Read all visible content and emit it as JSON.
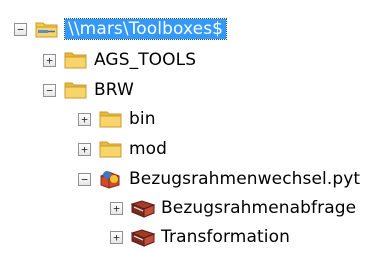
{
  "tree": {
    "root": {
      "label": "\\\\mars\\Toolboxes$",
      "toggle": "−",
      "icon": "folder-connection-icon",
      "selected": true
    },
    "items": [
      {
        "label": "AGS_TOOLS",
        "toggle": "+",
        "icon": "folder-icon"
      },
      {
        "label": "BRW",
        "toggle": "−",
        "icon": "folder-icon"
      },
      {
        "label": "bin",
        "toggle": "+",
        "icon": "folder-icon"
      },
      {
        "label": "mod",
        "toggle": "+",
        "icon": "folder-icon"
      },
      {
        "label": "Bezugsrahmenwechsel.pyt",
        "toggle": "−",
        "icon": "python-toolbox-icon"
      },
      {
        "label": "Bezugsrahmenabfrage",
        "toggle": "+",
        "icon": "toolset-icon"
      },
      {
        "label": "Transformation",
        "toggle": "+",
        "icon": "toolset-icon"
      }
    ]
  },
  "colors": {
    "selection": "#3399ff",
    "folder": "#f3c84e",
    "folder_dark": "#c89b2c"
  }
}
